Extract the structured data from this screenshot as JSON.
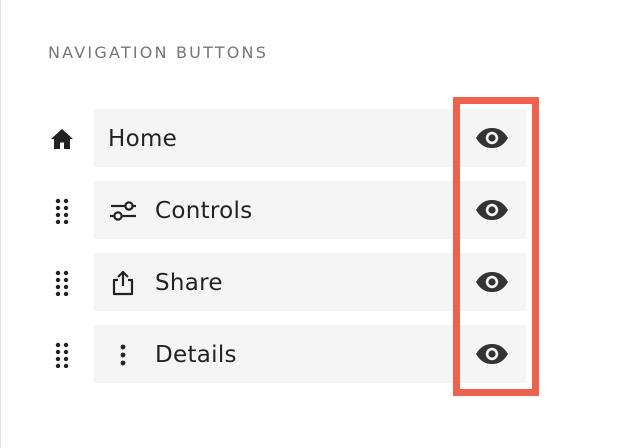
{
  "section": {
    "title": "NAVIGATION BUTTONS"
  },
  "items": [
    {
      "label": "Home",
      "lead_icon": "home-icon",
      "icon": "",
      "visibility_icon": "eye-icon"
    },
    {
      "label": "Controls",
      "lead_icon": "drag-handle-icon",
      "icon": "sliders-icon",
      "visibility_icon": "eye-icon"
    },
    {
      "label": "Share",
      "lead_icon": "drag-handle-icon",
      "icon": "share-icon",
      "visibility_icon": "eye-icon"
    },
    {
      "label": "Details",
      "lead_icon": "drag-handle-icon",
      "icon": "vertical-dots-icon",
      "visibility_icon": "eye-icon"
    }
  ],
  "colors": {
    "highlight": "#f0604f",
    "item_background": "#f5f5f5",
    "icon": "#333333",
    "section_title": "#767676"
  }
}
